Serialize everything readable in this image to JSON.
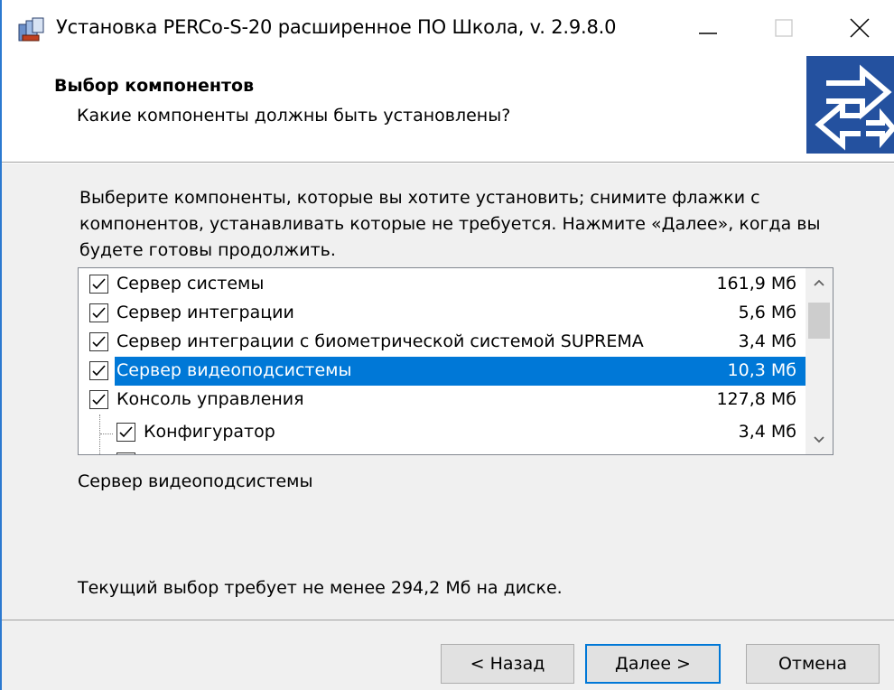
{
  "window": {
    "title": "Установка PERCo-S-20 расширенное ПО Школа, v. 2.9.8.0",
    "icons": {
      "app": "installer-icon",
      "minimize": "minimize-icon",
      "maximize": "maximize-icon",
      "close": "close-icon"
    }
  },
  "header": {
    "title": "Выбор компонентов",
    "subtitle": "Какие компоненты должны быть установлены?",
    "logo_icon": "arrows-logo-icon"
  },
  "instructions": "Выберите компоненты, которые вы хотите установить; снимите флажки с компонентов, устанавливать которые не требуется. Нажмите «Далее», когда вы будете готовы продолжить.",
  "components": [
    {
      "label": "Сервер системы",
      "size": "161,9 Мб",
      "checked": true,
      "level": 0,
      "selected": false
    },
    {
      "label": "Сервер интеграции",
      "size": "5,6 Мб",
      "checked": true,
      "level": 0,
      "selected": false
    },
    {
      "label": "Сервер интеграции с биометрической системой SUPREMA",
      "size": "3,4 Мб",
      "checked": true,
      "level": 0,
      "selected": false
    },
    {
      "label": "Сервер видеоподсистемы",
      "size": "10,3 Мб",
      "checked": true,
      "level": 0,
      "selected": true
    },
    {
      "label": "Консоль управления",
      "size": "127,8 Мб",
      "checked": true,
      "level": 0,
      "selected": false
    },
    {
      "label": "Конфигуратор",
      "size": "3,4 Мб",
      "checked": true,
      "level": 1,
      "selected": false
    }
  ],
  "description": "Сервер видеоподсистемы",
  "disk_info": "Текущий выбор требует не менее 294,2 Мб на диске.",
  "buttons": {
    "back": "< Назад",
    "next": "Далее >",
    "cancel": "Отмена"
  },
  "colors": {
    "selection": "#0078d7",
    "dialog_bg": "#f0f0f0",
    "logo_bg": "#1f4c9c"
  }
}
